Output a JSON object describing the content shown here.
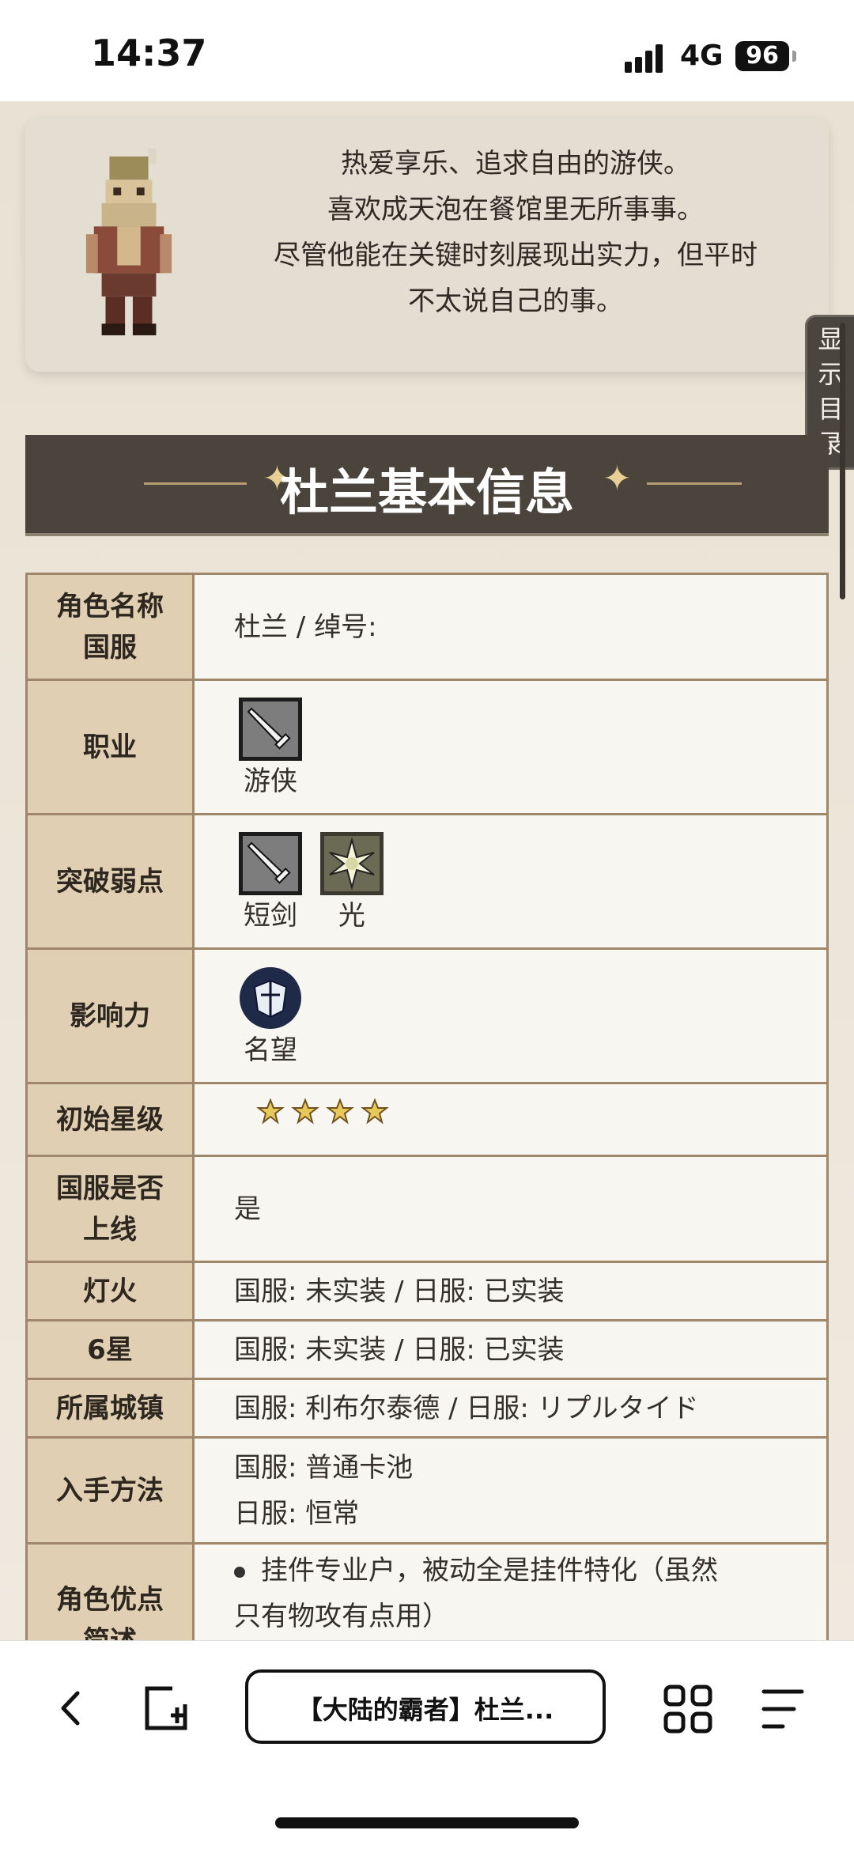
{
  "status": {
    "time": "14:37",
    "network": "4G",
    "battery": "96"
  },
  "intro": {
    "lines": [
      "热爱享乐、追求自由的游侠。",
      "喜欢成天泡在餐馆里无所事事。",
      "尽管他能在关键时刻展现出实力，但平时",
      "不太说自己的事。"
    ]
  },
  "toc_tab": {
    "chars": [
      "显",
      "示",
      "目",
      "录"
    ]
  },
  "section": {
    "title": "杜兰基本信息"
  },
  "table": {
    "name": {
      "key_line1": "角色名称",
      "key_line2": "国服",
      "value": "杜兰 / 绰号:"
    },
    "job": {
      "key": "职业",
      "icon": "dagger-icon",
      "label": "游侠"
    },
    "weakness": {
      "key": "突破弱点",
      "items": [
        {
          "icon": "dagger-icon",
          "label": "短剑"
        },
        {
          "icon": "light-icon",
          "label": "光"
        }
      ]
    },
    "influence": {
      "key": "影响力",
      "icon": "fame-icon",
      "label": "名望"
    },
    "stars": {
      "key": "初始星级",
      "count": 4
    },
    "cn_release": {
      "key_line1": "国服是否",
      "key_line2": "上线",
      "value": "是"
    },
    "lantern": {
      "key": "灯火",
      "value": "国服: 未实装 / 日服: 已实装"
    },
    "six_star": {
      "key": "6星",
      "value": "国服: 未实装 / 日服: 已实装"
    },
    "town": {
      "key": "所属城镇",
      "value": "国服: 利布尔泰德 / 日服: リプルタイド"
    },
    "obtain": {
      "key": "入手方法",
      "line1": "国服: 普通卡池",
      "line2": "日服: 恒常"
    },
    "merits": {
      "key_line1": "角色优点",
      "key_line2": "简述",
      "line1": "挂件专业户，被动全是挂件特化（虽然",
      "line2": "只有物攻有点用）"
    }
  },
  "toolbar": {
    "url_title": "【大陆的霸者】杜兰..."
  },
  "colors": {
    "banner": "#4a443c",
    "key_cell": "#e0cfb2",
    "border": "#a0866a"
  }
}
